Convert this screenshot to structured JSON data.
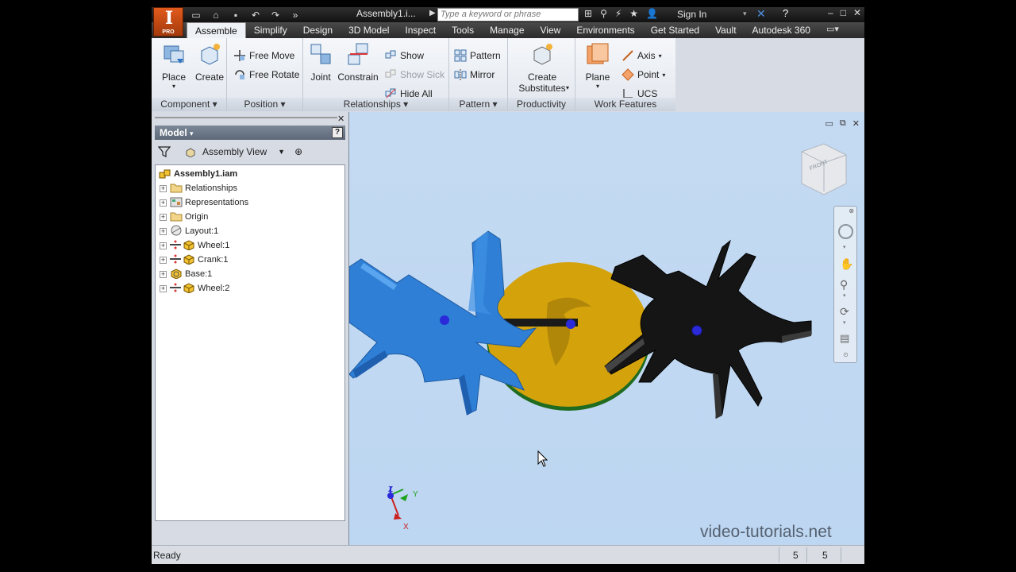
{
  "app": {
    "doc_title": "Assembly1.i...",
    "search_placeholder": "Type a keyword or phrase",
    "sign_in": "Sign In",
    "logo_text": "PRO"
  },
  "tabs": [
    "Assemble",
    "Simplify",
    "Design",
    "3D Model",
    "Inspect",
    "Tools",
    "Manage",
    "View",
    "Environments",
    "Get Started",
    "Vault",
    "Autodesk 360"
  ],
  "ribbon": {
    "component": {
      "label": "Component",
      "place": "Place",
      "create": "Create"
    },
    "position": {
      "label": "Position",
      "free_move": "Free Move",
      "free_rotate": "Free Rotate"
    },
    "relationships": {
      "label": "Relationships",
      "joint": "Joint",
      "constrain": "Constrain",
      "show": "Show",
      "show_sick": "Show Sick",
      "hide_all": "Hide All"
    },
    "pattern": {
      "label": "Pattern",
      "pattern": "Pattern",
      "mirror": "Mirror"
    },
    "productivity": {
      "label": "Productivity",
      "create_substitutes_1": "Create",
      "create_substitutes_2": "Substitutes"
    },
    "work_features": {
      "label": "Work Features",
      "plane": "Plane",
      "axis": "Axis",
      "point": "Point",
      "ucs": "UCS"
    }
  },
  "browser": {
    "title": "Model",
    "view_selector": "Assembly View",
    "root": "Assembly1.iam",
    "items": [
      "Relationships",
      "Representations",
      "Origin",
      "Layout:1",
      "Wheel:1",
      "Crank:1",
      "Base:1",
      "Wheel:2"
    ]
  },
  "viewport": {
    "watermark": "video-tutorials.net",
    "axis_x": "X",
    "axis_y": "Y",
    "axis_z": "Z",
    "viewcube_face": "FRONT"
  },
  "status": {
    "text": "Ready",
    "num1": "5",
    "num2": "5"
  },
  "colors": {
    "wheel_left": "#2f7fd6",
    "crank": "#d4a30c",
    "wheel_right": "#151515",
    "viewport_bg": "#c4daf2"
  }
}
